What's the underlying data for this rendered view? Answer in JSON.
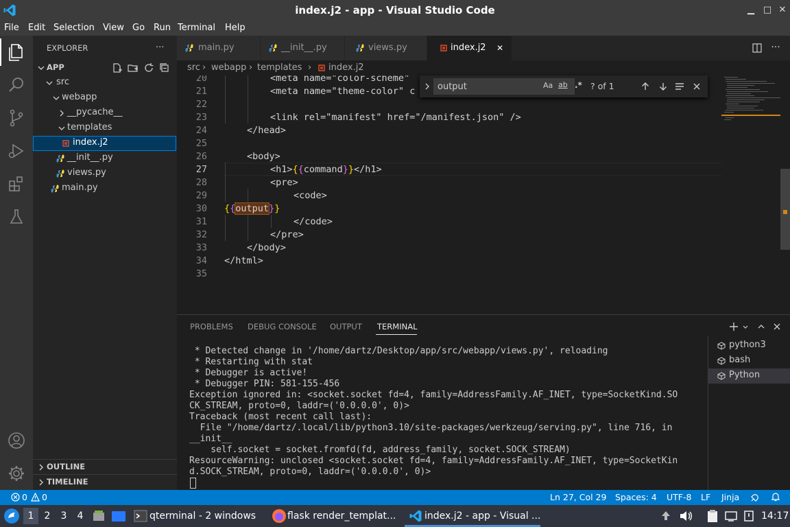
{
  "window": {
    "title": "index.j2 - app - Visual Studio Code"
  },
  "menu": [
    "File",
    "Edit",
    "Selection",
    "View",
    "Go",
    "Run",
    "Terminal",
    "Help"
  ],
  "sidebar": {
    "header": "EXPLORER",
    "more": "···",
    "root": "APP",
    "tree": [
      "src",
      "webapp",
      "__pycache__",
      "templates",
      "index.j2",
      "__init__.py",
      "views.py",
      "main.py"
    ],
    "outline": "OUTLINE",
    "timeline": "TIMELINE"
  },
  "tabs": [
    "main.py",
    "__init__.py",
    "views.py",
    "index.j2"
  ],
  "tab_close": "✕",
  "breadcrumb": [
    "src",
    "webapp",
    "templates",
    "index.j2"
  ],
  "editor": {
    "line_numbers": [
      "20",
      "21",
      "22",
      "23",
      "24",
      "25",
      "26",
      "27",
      "28",
      "29",
      "30",
      "31",
      "32",
      "33",
      "34",
      "35"
    ],
    "lines": {
      "l20": "<meta name=\"color-scheme\"",
      "l21": "<meta name=\"theme-color\" c",
      "l23": "<link rel=\"manifest\" href=\"/manifest.json\" />",
      "l24": "</head>",
      "l26": "<body>",
      "l27a": "<h1>",
      "l27b": "{",
      "l27c": "{",
      "l27d": "command",
      "l27e": "}",
      "l27f": "}",
      "l27g": "</h1>",
      "l28": "<pre>",
      "l29": "<code>",
      "l30a": "{",
      "l30b": "{",
      "l30c": "output",
      "l30d": "}",
      "l30e": "}",
      "l31": "</code>",
      "l32": "</pre>",
      "l33": "</body>",
      "l34": "</html>"
    }
  },
  "find": {
    "value": "output",
    "case": "Aa",
    "word": "ab",
    "regex": ".*",
    "count": "? of 1"
  },
  "panel": {
    "tabs": [
      "PROBLEMS",
      "DEBUG CONSOLE",
      "OUTPUT",
      "TERMINAL"
    ],
    "terminal_lines": [
      " * Detected change in '/home/dartz/Desktop/app/src/webapp/views.py', reloading",
      " * Restarting with stat",
      " * Debugger is active!",
      " * Debugger PIN: 581-155-456",
      "Exception ignored in: <socket.socket fd=4, family=AddressFamily.AF_INET, type=SocketKind.SO",
      "CK_STREAM, proto=0, laddr=('0.0.0.0', 0)>",
      "Traceback (most recent call last):",
      "  File \"/home/dartz/.local/lib/python3.10/site-packages/werkzeug/serving.py\", line 716, in",
      "__init__",
      "    self.socket = socket.fromfd(fd, address_family, socket.SOCK_STREAM)",
      "ResourceWarning: unclosed <socket.socket fd=4, family=AddressFamily.AF_INET, type=SocketKin",
      "d.SOCK_STREAM, proto=0, laddr=('0.0.0.0', 0)>"
    ],
    "terminals": [
      "python3",
      "bash",
      "Python"
    ]
  },
  "status": {
    "errors": "0",
    "warnings": "0",
    "position": "Ln 27, Col 29",
    "spaces": "Spaces: 4",
    "encoding": "UTF-8",
    "eol": "LF",
    "language": "Jinja"
  },
  "taskbar": {
    "workspaces": [
      "1",
      "2",
      "3",
      "4"
    ],
    "apps": [
      "qterminal - 2 windows",
      "flask render_templat...",
      "index.j2 - app - Visual ..."
    ],
    "clock": "14:17"
  },
  "colors": {
    "accent": "#007acc",
    "titlebar": "#3c3c3c",
    "editor_bg": "#1e1e1e",
    "sidebar_bg": "#252526"
  }
}
